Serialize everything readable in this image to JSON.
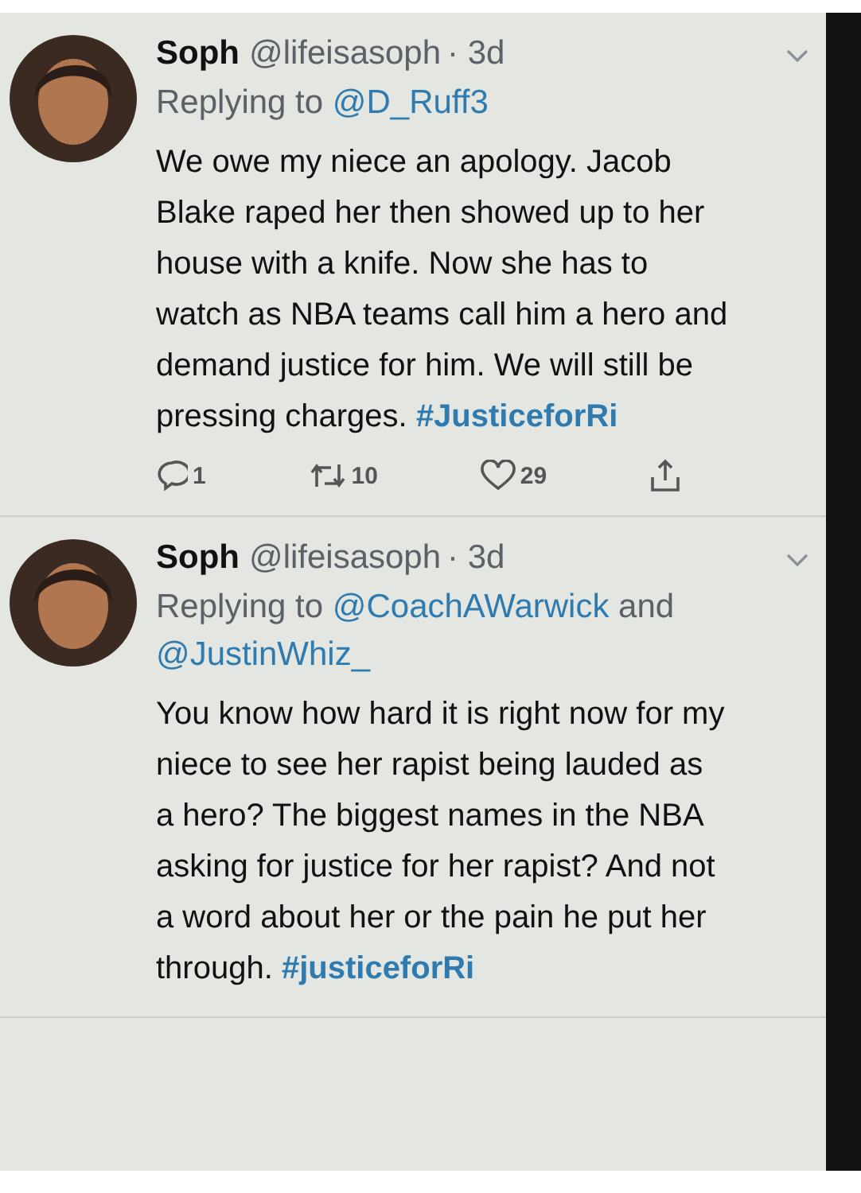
{
  "tweets": [
    {
      "name": "Soph",
      "handle": "@lifeisasoph",
      "time": "· 3d",
      "replying_prefix": "Replying to",
      "mentions": [
        "@D_Ruff3"
      ],
      "body": "We owe my niece an apology. Jacob Blake raped her then showed up to her house with a knife. Now she has to watch as NBA teams call him a hero and demand justice for him. We will still be pressing charges.",
      "hashtag": "#JusticeforRi",
      "actions": [
        {
          "kind": "reply",
          "count": "1"
        },
        {
          "kind": "retweet",
          "count": "10"
        },
        {
          "kind": "like",
          "count": "29"
        },
        {
          "kind": "share"
        }
      ]
    },
    {
      "name": "Soph",
      "handle": "@lifeisasoph",
      "time": "· 3d",
      "replying_prefix": "Replying to",
      "mentions": [
        "@CoachAWarwick",
        "@JustinWhiz_"
      ],
      "joiner": "and",
      "body": "You know how hard it is right now for my niece to see her rapist being lauded as a hero? The biggest names in the NBA asking for justice for her rapist? And not a word about her or the pain he put her through.",
      "hashtag": "#justiceforRi"
    }
  ]
}
